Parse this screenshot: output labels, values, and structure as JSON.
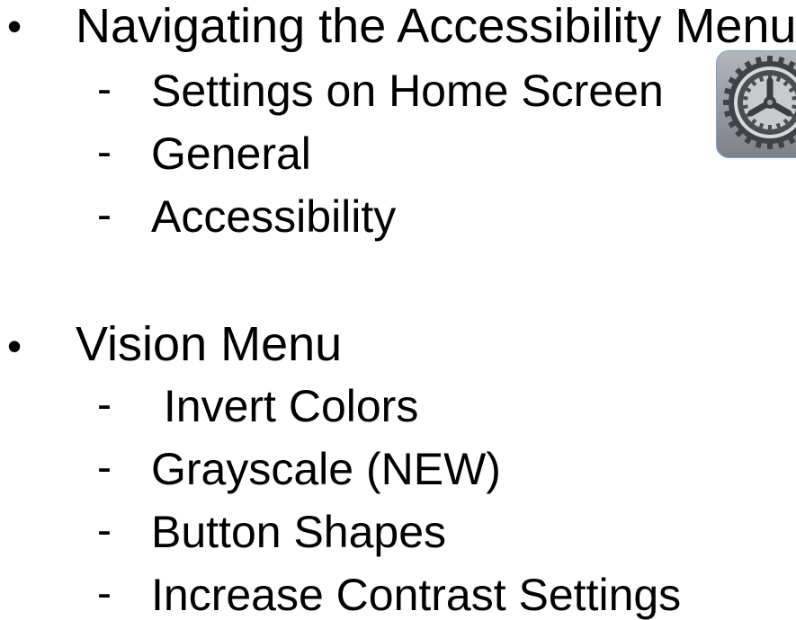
{
  "slide": {
    "sections": [
      {
        "bullet": "•",
        "title": "Navigating the Accessibility Menu",
        "items": [
          {
            "marker": "-",
            "text": "Settings on Home Screen"
          },
          {
            "marker": "-",
            "text": "General"
          },
          {
            "marker": "-",
            "text": "Accessibility"
          }
        ]
      },
      {
        "bullet": "•",
        "title": "Vision Menu",
        "items": [
          {
            "marker": "-",
            "text": " Invert Colors"
          },
          {
            "marker": "-",
            "text": "Grayscale (NEW)"
          },
          {
            "marker": "-",
            "text": "Button Shapes"
          },
          {
            "marker": "-",
            "text": "Increase Contrast Settings"
          }
        ]
      }
    ],
    "icon": {
      "name": "settings-gear-icon",
      "colors": {
        "background": "#8a8e95",
        "gear": "#4a4d52",
        "highlight": "#d7d9dc",
        "border": "#6fa3d6"
      }
    }
  }
}
